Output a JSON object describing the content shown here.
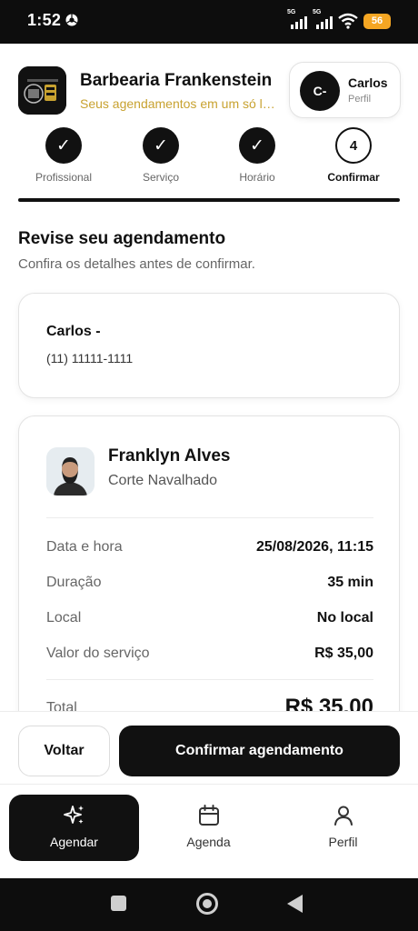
{
  "status_bar": {
    "time": "1:52",
    "signal1": "5G",
    "signal2": "5G",
    "battery": "56",
    "battery_color": "#f5a623"
  },
  "header": {
    "shop_name": "Barbearia Frankenstein",
    "shop_subtitle": "Seus agendamentos em um só lugar",
    "user_initials": "C-",
    "user_name": "Carlos",
    "user_role": "Perfil",
    "accent_color": "#c8a230"
  },
  "stepper": {
    "steps": [
      {
        "label": "Profissional",
        "mark": "✓",
        "done": true
      },
      {
        "label": "Serviço",
        "mark": "✓",
        "done": true
      },
      {
        "label": "Horário",
        "mark": "✓",
        "done": true
      },
      {
        "label": "Confirmar",
        "mark": "4",
        "done": false
      }
    ]
  },
  "review": {
    "title": "Revise seu agendamento",
    "subtitle": "Confira os detalhes antes de confirmar."
  },
  "client": {
    "name": "Carlos -",
    "phone": "(11) 11111-1111"
  },
  "details": {
    "barber_name": "Franklyn Alves",
    "service": "Corte Navalhado",
    "rows": [
      {
        "key": "Data e hora",
        "value": "25/08/2026, 11:15"
      },
      {
        "key": "Duração",
        "value": "35 min"
      },
      {
        "key": "Local",
        "value": "No local"
      },
      {
        "key": "Valor do serviço",
        "value": "R$ 35,00"
      }
    ],
    "total_label": "Total",
    "total_value": "R$ 35,00"
  },
  "actions": {
    "back_label": "Voltar",
    "confirm_label": "Confirmar agendamento"
  },
  "bottom_nav": {
    "items": [
      {
        "label": "Agendar",
        "icon": "sparkles-icon",
        "active": true
      },
      {
        "label": "Agenda",
        "icon": "calendar-icon",
        "active": false
      },
      {
        "label": "Perfil",
        "icon": "user-icon",
        "active": false
      }
    ]
  }
}
